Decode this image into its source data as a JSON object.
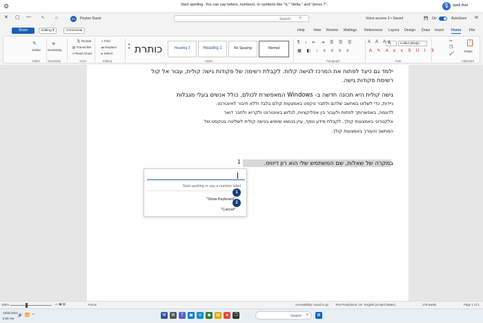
{
  "voice_access": {
    "message": "Start spelling. You can say letters, numbers, or symbols like \"d,\" \"delta,\" and \"press 7\".",
    "spell_label": "spell that",
    "icons": {
      "settings": "gear-icon",
      "mic": "microphone-icon"
    }
  },
  "titlebar": {
    "autosave_label": "AutoSave",
    "autosave_state": "On",
    "doc_title": "Voice access 2 • Saved",
    "search_placeholder": "Search",
    "user_name": "Peyton Davis",
    "user_initials": "PD"
  },
  "tabs": [
    "File",
    "Home",
    "Insert",
    "Draw",
    "Design",
    "Layout",
    "References",
    "Mailings",
    "Review",
    "View",
    "Help"
  ],
  "active_tab": "Home",
  "actions": {
    "share": "Share",
    "editing": "Editing",
    "comments": "Comments"
  },
  "ribbon": {
    "clipboard_label": "Clipboard",
    "paste_label": "Paste",
    "font_label": "Font",
    "font_name": "Calibri (Body)",
    "font_size": "11",
    "paragraph_label": "Paragraph",
    "styles_label": "Styles",
    "styles": [
      "Normal",
      "No Spacing",
      "Heading 1",
      "Heading 2"
    ],
    "title_style": "כותרת",
    "editing_group_label": "Editing",
    "find": "Find",
    "replace": "Replace",
    "select": "Select",
    "voice_label": "Voice",
    "dictate": "Dictate",
    "transcribe": "Transcribe",
    "read_aloud": "Read Aloud",
    "sensitivity": "Sensitivity",
    "editor": "Editor"
  },
  "document": {
    "lines": [
      "ילמד גם כיצד לפתוח את המרכז לגישה קלות. לקבלת רשימה של פקודות גישה קולית, עבור אל קול",
      "רשימת פקודות גישה.",
      "גישה קולית היא תכונה חדשה ב- Windows המאפשרת לכולם, כולל אנשים בעלי מגבלות",
      "ניידות, כדי לשלוט במחשב שלהם ולחבר טקסט באמצעות קולם בלבד וללא חיבור לאינטרנט.",
      "לדוגמה, באפשרותך לפתוח ולעבור בין אפליקציות, לגלוש באינטרנט ולקרוא ולחבר דואר",
      "אלקטרוני באמצעות קולך. לקבלת מידע נוסף, עיין בנושא שימוש בגישה קולית לשליטה בטקסט של",
      "המחשב והעורך באמצעות קולך."
    ],
    "selected_line": "במקרה של שאלות, שם המשתמש שלי הוא רון דיוויס.",
    "cursor_number": "1"
  },
  "spell_popup": {
    "placeholder": "Start spelling or say a number label",
    "options": [
      {
        "number": "1",
        "label": "\"Show Keyboard\""
      },
      {
        "number": "2",
        "label": "\"Cancel\""
      }
    ]
  },
  "statusbar": {
    "page": "Page 1 of 1",
    "words": "176 words",
    "language": "English (United States)",
    "predictions": "Text Predictions: On",
    "accessibility": "Accessibility: Good to go",
    "focus": "Focus",
    "zoom": "100%"
  },
  "taskbar": {
    "search_placeholder": "Search",
    "time": "9:28 AM",
    "date": "10/31/2022"
  }
}
